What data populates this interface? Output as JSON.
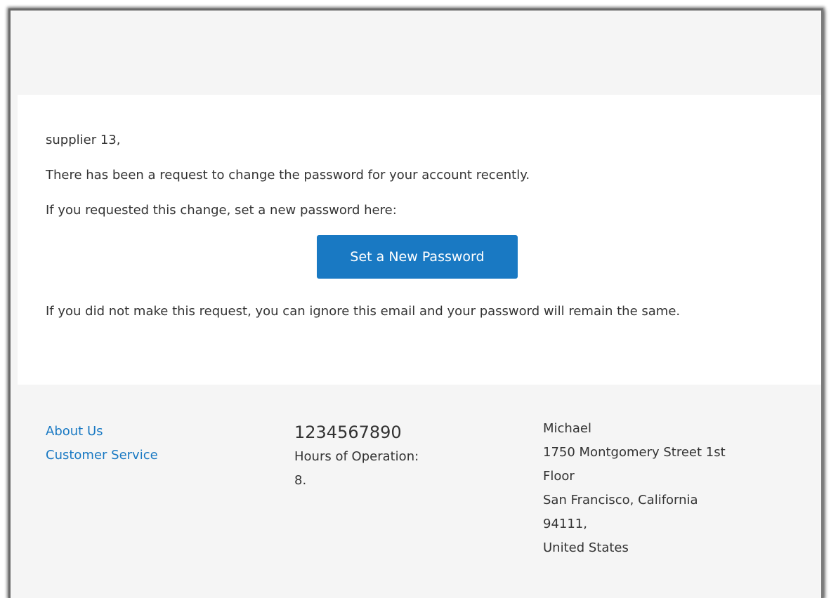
{
  "email": {
    "greeting": "supplier 13,",
    "paragraph_request": "There has been a request to change the password for your account recently.",
    "paragraph_if_requested": "If you requested this change, set a new password here:",
    "button_label": "Set a New Password",
    "paragraph_ignore": "If you did not make this request, you can ignore this email and your password will remain the same."
  },
  "footer": {
    "links": [
      {
        "label": "About Us"
      },
      {
        "label": "Customer Service"
      }
    ],
    "phone": "1234567890",
    "hours_label": "Hours of Operation:",
    "hours_value": "8.",
    "address": {
      "line1": "Michael",
      "line2": "1750 Montgomery Street 1st",
      "line3": "Floor",
      "line4": "San Francisco, California",
      "line5": "94111,",
      "line6": "United States"
    }
  },
  "colors": {
    "accent": "#1979c3",
    "text": "#333333",
    "panel_bg": "#f5f5f5",
    "content_bg": "#ffffff"
  }
}
